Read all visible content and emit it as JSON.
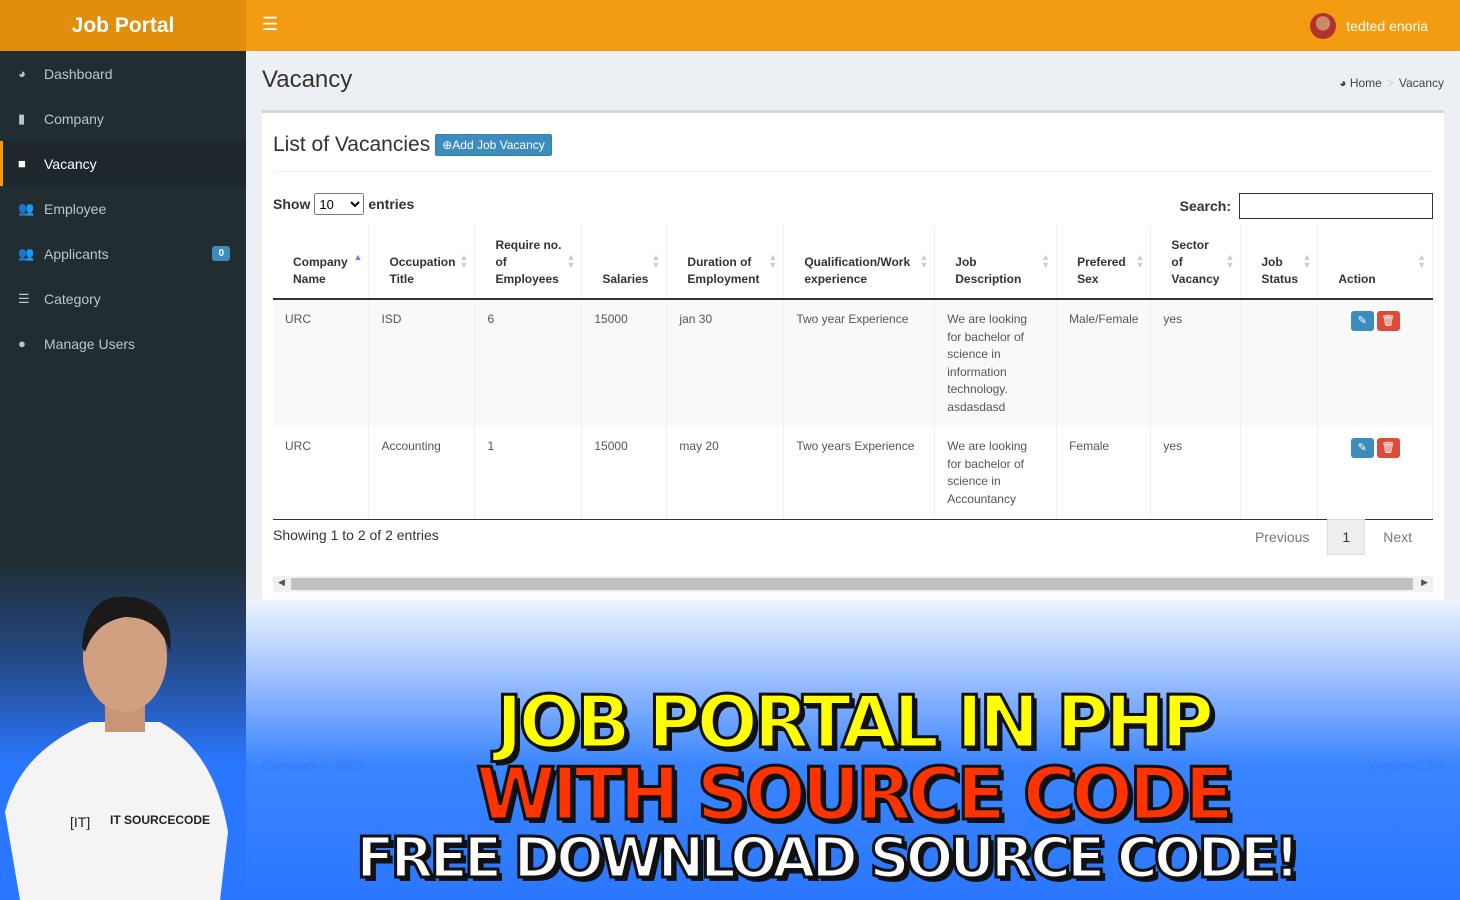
{
  "app": {
    "title": "Job Portal",
    "user": "tedted enoria"
  },
  "sidebar": {
    "items": [
      {
        "label": "Dashboard",
        "icon": "dashboard-icon"
      },
      {
        "label": "Company",
        "icon": "building-icon"
      },
      {
        "label": "Vacancy",
        "icon": "briefcase-icon",
        "active": true
      },
      {
        "label": "Employee",
        "icon": "users-icon"
      },
      {
        "label": "Applicants",
        "icon": "users-icon",
        "badge": "0"
      },
      {
        "label": "Category",
        "icon": "list-icon"
      },
      {
        "label": "Manage Users",
        "icon": "user-icon"
      }
    ]
  },
  "page": {
    "title": "Vacancy",
    "breadcrumb": [
      "Home",
      "Vacancy"
    ]
  },
  "box": {
    "title": "List of Vacancies",
    "add_label": "Add Job Vacancy",
    "show": "Show",
    "entries": "entries",
    "page_size": "10",
    "search_label": "Search:",
    "search_value": ""
  },
  "table": {
    "headers": [
      [
        "Company",
        "Name"
      ],
      [
        "Occupation",
        "Title"
      ],
      [
        "Require no.",
        "of",
        "Employees"
      ],
      [
        "Salaries"
      ],
      [
        "Duration of",
        "Employment"
      ],
      [
        "Qualification/Work",
        "experience"
      ],
      [
        "Job",
        "Description"
      ],
      [
        "Prefered",
        "Sex"
      ],
      [
        "Sector",
        "of",
        "Vacancy"
      ],
      [
        "Job",
        "Status"
      ],
      [
        "Action"
      ]
    ],
    "rows": [
      [
        "URC",
        "ISD",
        "6",
        "15000",
        "jan 30",
        "Two year Experience",
        "We are looking for bachelor of science in information technology. asdasdasd",
        "Male/Female",
        "yes",
        ""
      ],
      [
        "URC",
        "Accounting",
        "1",
        "15000",
        "may 20",
        "Two years Experience",
        "We are looking for bachelor of science in Accountancy",
        "Female",
        "yes",
        ""
      ]
    ]
  },
  "pagination": {
    "info": "Showing 1 to 2 of 2 entries",
    "previous": "Previous",
    "current": "1",
    "next": "Next"
  },
  "footer": {
    "copyright": "Copyright © 2022",
    "version": "Version 2.3.2"
  },
  "banner": {
    "line1": "JOB PORTAL IN PHP",
    "line2": "WITH SOURCE CODE",
    "line3": "FREE DOWNLOAD SOURCE CODE!",
    "shirt_logo": "IT SOURCECODE"
  },
  "colors": {
    "topbar": "#f39c12",
    "sidebar": "#222d32",
    "primary": "#3c8dbc",
    "danger": "#dd4b39"
  }
}
